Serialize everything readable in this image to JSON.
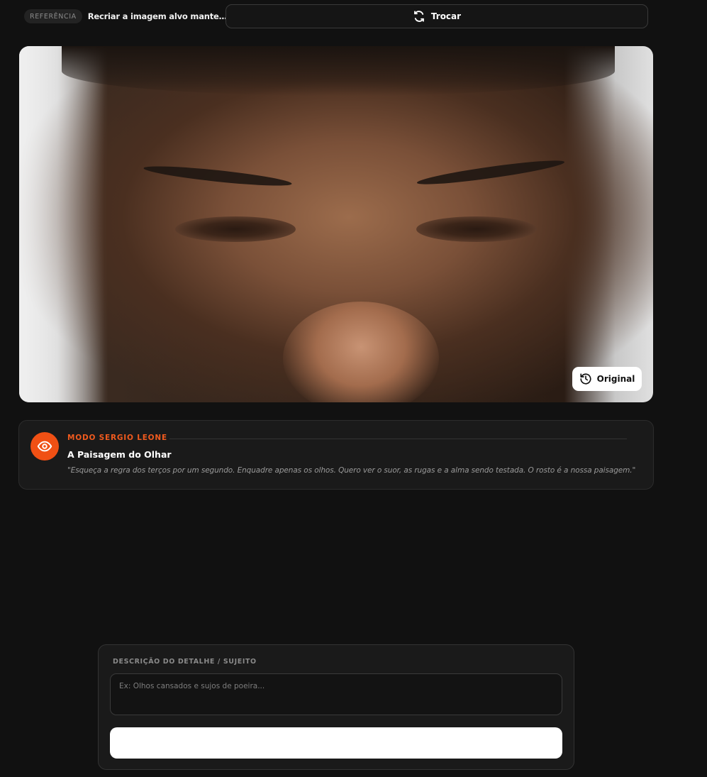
{
  "header": {
    "reference_badge": "REFERÊNCIA",
    "reference_text": "Recriar a imagem alvo mantendo s...",
    "swap_label": "Trocar",
    "swap_icon": "swap-icon"
  },
  "photo": {
    "alt": "Close-up portrait of a man's weathered face focused on the eyes",
    "original_label": "Original",
    "original_icon": "history-icon"
  },
  "mode": {
    "tag": "MODO SERGIO LEONE",
    "title": "A Paisagem do Olhar",
    "quote": "\"Esqueça a regra dos terços por um segundo. Enquadre apenas os olhos. Quero ver o suor, as rugas e a alma sendo testada. O rosto é a nossa paisagem.\"",
    "icon": "eye-icon",
    "accent_color": "#f05014"
  },
  "form": {
    "label": "DESCRIÇÃO DO DETALHE / SUJEITO",
    "value": "",
    "placeholder": "Ex: Olhos cansados e sujos de poeira...",
    "submit_label": ""
  }
}
